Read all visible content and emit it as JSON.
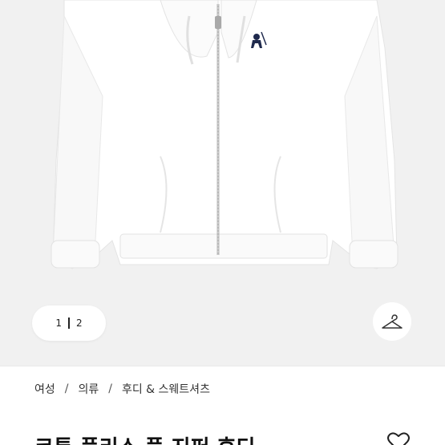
{
  "gallery": {
    "current_page": "1",
    "total_pages": "2",
    "colors": {
      "background": "#f1f1f1",
      "garment": "#ffffff",
      "logo": "#1f2a4d"
    }
  },
  "icons": {
    "hanger": "hanger-icon",
    "heart": "heart-icon"
  },
  "breadcrumb": {
    "items": [
      "여성",
      "의류",
      "후디 & 스웨트셔츠"
    ],
    "separator": "/"
  },
  "product": {
    "title": "코튼 플리스 풀 지퍼 후디"
  }
}
